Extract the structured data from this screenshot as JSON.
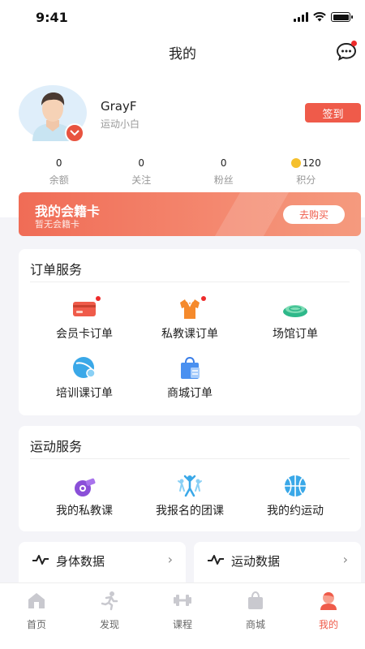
{
  "status_bar": {
    "time": "9:41"
  },
  "nav": {
    "title": "我的"
  },
  "profile": {
    "name": "GrayF",
    "level": "运动小白",
    "signin_label": "签到"
  },
  "stats": [
    {
      "value": "0",
      "label": "余额"
    },
    {
      "value": "0",
      "label": "关注"
    },
    {
      "value": "0",
      "label": "粉丝"
    },
    {
      "value": "120",
      "label": "积分",
      "icon": "coin-icon"
    }
  ],
  "member_card": {
    "title": "我的会籍卡",
    "subtitle": "暂无会籍卡",
    "buy_label": "去购买"
  },
  "order_services": {
    "title": "订单服务",
    "items": [
      {
        "label": "会员卡订单",
        "icon": "card-icon",
        "badge": true
      },
      {
        "label": "私教课订单",
        "icon": "shirt-icon",
        "badge": true
      },
      {
        "label": "场馆订单",
        "icon": "venue-icon",
        "badge": false
      },
      {
        "label": "培训课订单",
        "icon": "training-icon",
        "badge": false
      },
      {
        "label": "商城订单",
        "icon": "shop-bag-icon",
        "badge": false
      }
    ]
  },
  "sport_services": {
    "title": "运动服务",
    "items": [
      {
        "label": "我的私教课",
        "icon": "whistle-icon"
      },
      {
        "label": "我报名的团课",
        "icon": "group-icon"
      },
      {
        "label": "我的约运动",
        "icon": "basketball-icon"
      }
    ]
  },
  "data_cards": [
    {
      "title": "身体数据",
      "icon": "pulse-icon"
    },
    {
      "title": "运动数据",
      "icon": "pulse-icon"
    }
  ],
  "tabbar": [
    {
      "label": "首页",
      "icon": "home-icon"
    },
    {
      "label": "发现",
      "icon": "runner-icon"
    },
    {
      "label": "课程",
      "icon": "dumbbell-icon"
    },
    {
      "label": "商城",
      "icon": "bag-icon"
    },
    {
      "label": "我的",
      "icon": "profile-icon",
      "active": true
    }
  ],
  "colors": {
    "accent": "#ef5b4a",
    "background": "#f4f4f8"
  }
}
